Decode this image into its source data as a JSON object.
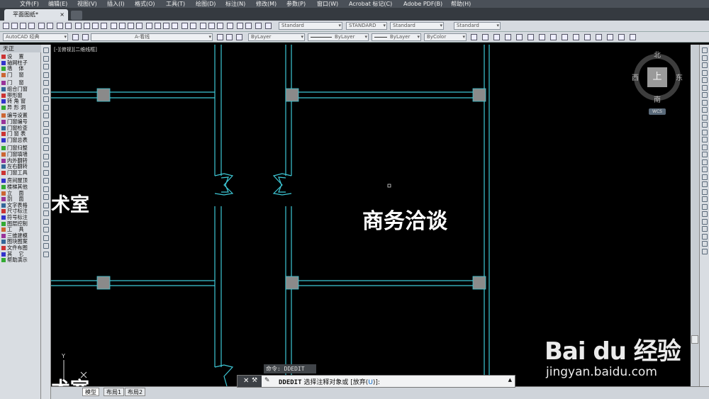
{
  "menu": [
    "文件(F)",
    "编辑(E)",
    "视图(V)",
    "插入(I)",
    "格式(O)",
    "工具(T)",
    "绘图(D)",
    "标注(N)",
    "修改(M)",
    "参数(P)",
    "窗口(W)",
    "Acrobat 标记(C)",
    "Adobe PDF(B)",
    "帮助(H)"
  ],
  "document_tab": {
    "title": "平面图纸*",
    "close": "×"
  },
  "toolbar": {
    "workspace": "AutoCAD 经典",
    "layer": "A-看线",
    "color": "ByLayer",
    "linetype": "ByLayer",
    "lineweight": "ByLayer",
    "plotstyle": "ByColor",
    "text_style": "Standard",
    "dim_style": "STANDARD",
    "table_style": "Standard",
    "mleader_style": "Standard"
  },
  "palette": {
    "title": "天正",
    "items": [
      "设    置",
      "轴网柱子",
      "墙    体",
      "门    窗",
      "门    窗",
      "组合门窗",
      "带形窗",
      "转 角 窗",
      "异 形 洞",
      "编号设置",
      "门窗编号",
      "门窗检查",
      "门 窗 表",
      "门窗总表",
      "门窗归整",
      "门窗填墙",
      "内外翻转",
      "左右翻转",
      "门窗工具",
      "房间屋顶",
      "楼梯其他",
      "立    面",
      "剖    面",
      "文字表格",
      "尺寸标注",
      "符号标注",
      "图层控制",
      "工    具",
      "三维建模",
      "图块图案",
      "文件布图",
      "其    它",
      "帮助演示"
    ]
  },
  "canvas": {
    "viewport_label": "[-][俯视][二维线框]",
    "rooms": [
      "术室",
      "商务洽谈",
      "术室"
    ]
  },
  "viewcube": {
    "north": "北",
    "south": "南",
    "east": "东",
    "west": "西",
    "face": "上",
    "ucs": "WCS"
  },
  "ucs_icon": {
    "y": "Y"
  },
  "layout_tabs": [
    "模型",
    "布局1",
    "布局2"
  ],
  "command": {
    "history": "命令: DDEDIT",
    "name": "DDEDIT",
    "prompt": "选择注释对象或",
    "option_open": "[放弃(",
    "option_key": "U",
    "option_close": ")]:"
  },
  "watermark": {
    "logo": "Bai du 经验",
    "url": "jingyan.baidu.com"
  },
  "colors": {
    "wall": "#3ec8d6",
    "column": "#8a8a8a",
    "background": "#000000"
  }
}
